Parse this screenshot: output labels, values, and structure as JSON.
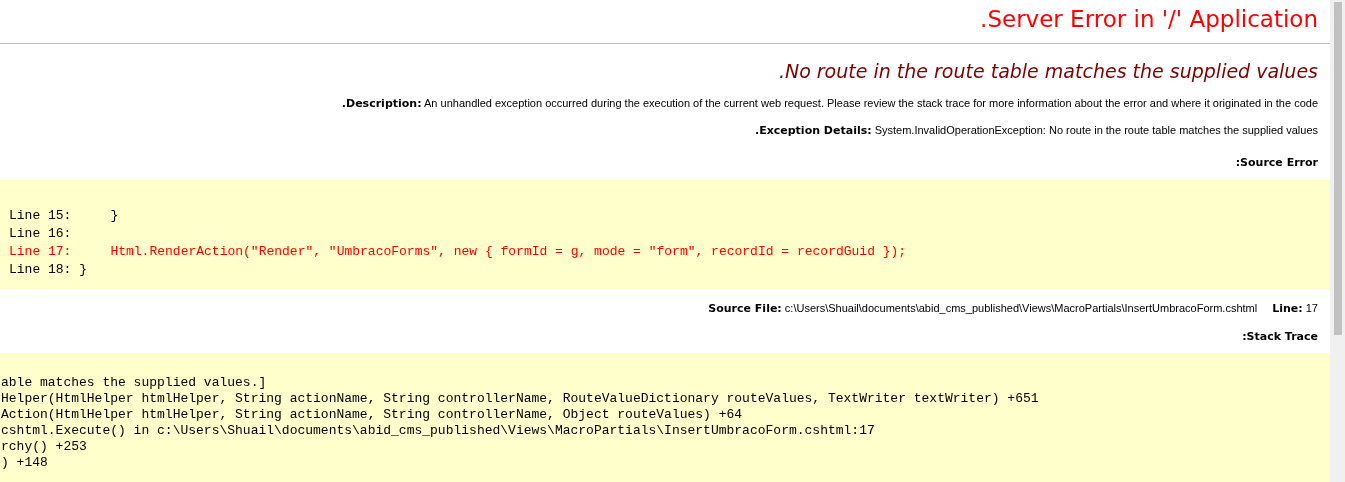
{
  "title": ".Server Error in '/' Application",
  "message": ".No route in the route table matches the supplied values",
  "description": {
    "label": ".Description:",
    "text": "An unhandled exception occurred during the execution of the current web request. Please review the stack trace for more information about the error and where it originated in the code"
  },
  "exception_details": {
    "label": ".Exception Details:",
    "text": "System.InvalidOperationException: No route in the route table matches the supplied values"
  },
  "source_error_heading": ":Source Error",
  "source_lines": [
    {
      "text": "Line 15:     }",
      "highlighted": false
    },
    {
      "text": "Line 16:",
      "highlighted": false
    },
    {
      "text": "Line 17:     Html.RenderAction(\"Render\", \"UmbracoForms\", new { formId = g, mode = \"form\", recordId = recordGuid });",
      "highlighted": true
    },
    {
      "text": "Line 18: }",
      "highlighted": false
    }
  ],
  "source_file": {
    "label": "Source File:",
    "path": "c:\\Users\\Shuail\\documents\\abid_cms_published\\Views\\MacroPartials\\InsertUmbracoForm.cshtml",
    "line_label": "Line:",
    "line": "17"
  },
  "stack_trace_heading": ":Stack Trace",
  "stack_trace_lines": [
    "able matches the supplied values.]",
    "Helper(HtmlHelper htmlHelper, String actionName, String controllerName, RouteValueDictionary routeValues, TextWriter textWriter) +651",
    "Action(HtmlHelper htmlHelper, String actionName, String controllerName, Object routeValues) +64",
    "cshtml.Execute() in c:\\Users\\Shuail\\documents\\abid_cms_published\\Views\\MacroPartials\\InsertUmbracoForm.cshtml:17",
    "rchy() +253",
    ") +148"
  ]
}
